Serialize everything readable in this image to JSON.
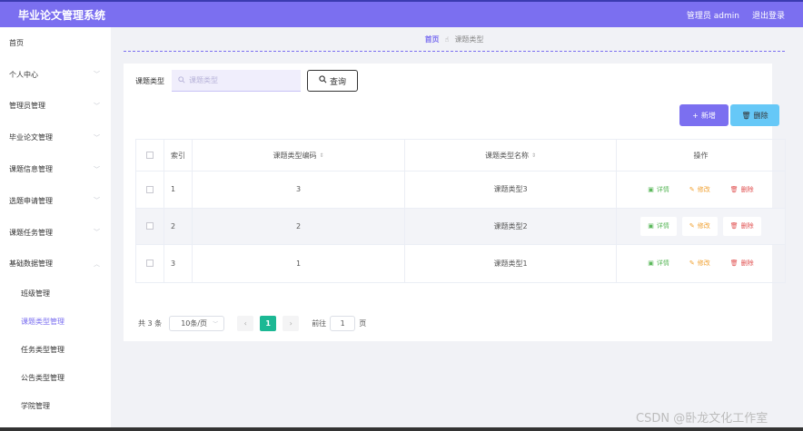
{
  "header": {
    "title": "毕业论文管理系统",
    "user": "管理员 admin",
    "logout": "退出登录"
  },
  "sidebar": {
    "items": [
      {
        "label": "首页",
        "chevron": false
      },
      {
        "label": "个人中心",
        "chevron": true
      },
      {
        "label": "管理员管理",
        "chevron": true
      },
      {
        "label": "毕业论文管理",
        "chevron": true
      },
      {
        "label": "课题信息管理",
        "chevron": true
      },
      {
        "label": "选题申请管理",
        "chevron": true
      },
      {
        "label": "课题任务管理",
        "chevron": true
      },
      {
        "label": "基础数据管理",
        "chevron": true
      }
    ],
    "subitems": [
      {
        "label": "班级管理",
        "active": false
      },
      {
        "label": "课题类型管理",
        "active": true
      },
      {
        "label": "任务类型管理",
        "active": false
      },
      {
        "label": "公告类型管理",
        "active": false
      },
      {
        "label": "学院管理",
        "active": false
      }
    ]
  },
  "breadcrumb": {
    "home": "首页",
    "current": "课题类型"
  },
  "search": {
    "label": "课题类型",
    "placeholder": "课题类型",
    "button": "查询"
  },
  "actions": {
    "add": "新增",
    "delete": "删除"
  },
  "table": {
    "headers": {
      "index": "索引",
      "code": "课题类型编码",
      "name": "课题类型名称",
      "ops": "操作"
    },
    "rows": [
      {
        "index": "1",
        "code": "3",
        "name": "课题类型3"
      },
      {
        "index": "2",
        "code": "2",
        "name": "课题类型2"
      },
      {
        "index": "3",
        "code": "1",
        "name": "课题类型1"
      }
    ],
    "ops": {
      "detail": "详情",
      "edit": "修改",
      "delete": "删除"
    }
  },
  "pagination": {
    "total": "共 3 条",
    "page_size": "10条/页",
    "current_page": "1",
    "goto_label": "前往",
    "goto_value": "1",
    "page_unit": "页"
  },
  "watermark": "CSDN @卧龙文化工作室",
  "colors": {
    "accent": "#7b6ff0",
    "delete_btn": "#66c8f7",
    "page_active": "#1cb894"
  }
}
